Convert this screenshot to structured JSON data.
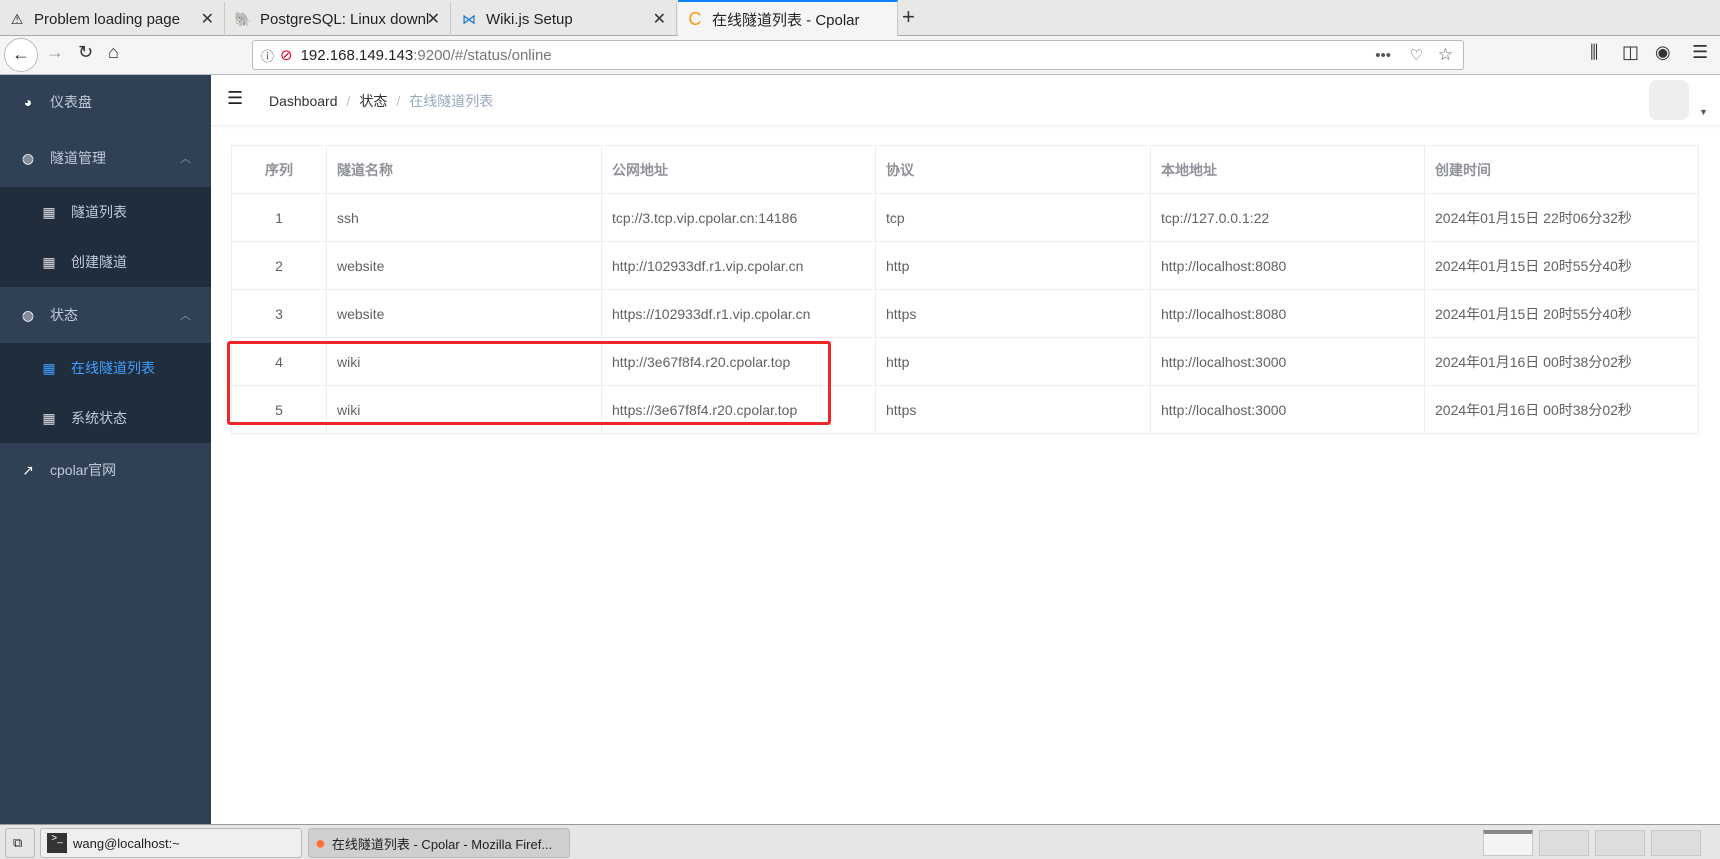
{
  "browser": {
    "tabs": [
      {
        "title": "Problem loading page",
        "icon": "warning-icon"
      },
      {
        "title": "PostgreSQL: Linux downlo",
        "icon": "postgres-icon"
      },
      {
        "title": "Wiki.js Setup",
        "icon": "wikijs-icon"
      },
      {
        "title": "在线隧道列表 - Cpolar",
        "icon": "cpolar-icon"
      }
    ],
    "url_host": "192.168.149.143",
    "url_path": ":9200/#/status/online"
  },
  "sidebar": {
    "items": [
      {
        "label": "仪表盘",
        "icon": "dashboard-icon"
      },
      {
        "label": "隧道管理",
        "icon": "lifebuoy-icon"
      },
      {
        "label": "隧道列表",
        "icon": "table-icon"
      },
      {
        "label": "创建隧道",
        "icon": "table-icon"
      },
      {
        "label": "状态",
        "icon": "lifebuoy-icon"
      },
      {
        "label": "在线隧道列表",
        "icon": "table-icon"
      },
      {
        "label": "系统状态",
        "icon": "table-icon"
      },
      {
        "label": "cpolar官网",
        "icon": "external-link-icon"
      }
    ]
  },
  "breadcrumb": [
    "Dashboard",
    "状态",
    "在线隧道列表"
  ],
  "table": {
    "headers": [
      "序列",
      "隧道名称",
      "公网地址",
      "协议",
      "本地地址",
      "创建时间"
    ],
    "rows": [
      [
        "1",
        "ssh",
        "tcp://3.tcp.vip.cpolar.cn:14186",
        "tcp",
        "tcp://127.0.0.1:22",
        "2024年01月15日 22时06分32秒"
      ],
      [
        "2",
        "website",
        "http://102933df.r1.vip.cpolar.cn",
        "http",
        "http://localhost:8080",
        "2024年01月15日 20时55分40秒"
      ],
      [
        "3",
        "website",
        "https://102933df.r1.vip.cpolar.cn",
        "https",
        "http://localhost:8080",
        "2024年01月15日 20时55分40秒"
      ],
      [
        "4",
        "wiki",
        "http://3e67f8f4.r20.cpolar.top",
        "http",
        "http://localhost:3000",
        "2024年01月16日 00时38分02秒"
      ],
      [
        "5",
        "wiki",
        "https://3e67f8f4.r20.cpolar.top",
        "https",
        "http://localhost:3000",
        "2024年01月16日 00时38分02秒"
      ]
    ]
  },
  "taskbar": {
    "terminal": "wang@localhost:~",
    "firefox": "在线隧道列表 - Cpolar - Mozilla Firef..."
  },
  "colors": {
    "sidebar": "#304156",
    "submenu": "#1f2d3d",
    "active": "#409eff",
    "highlight": "#f0272a"
  }
}
